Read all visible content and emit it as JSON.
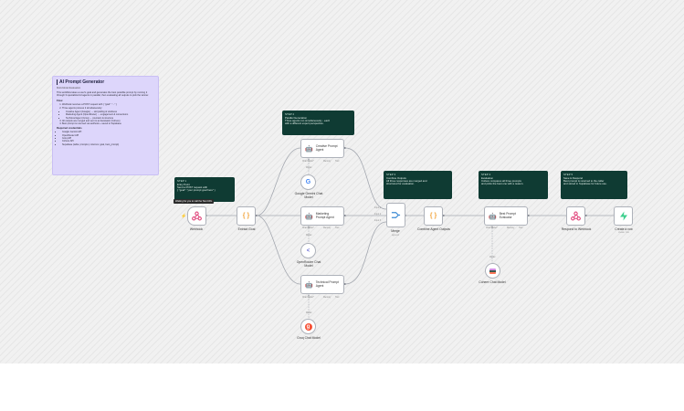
{
  "note": {
    "title": "AI Prompt Generator",
    "subtitle": "Multi-Model Evaluation",
    "description": "This workflow takes a user's goal and generates the best possible prompt by running it through 3 specialized AI agents in parallel, then evaluating all outputs to pick the winner.",
    "flow_heading": "Flow",
    "flow_steps": [
      "Webhook receives a POST request with { \"goal\": \"...\" }",
      "Three agents process it simultaneously:"
    ],
    "flow_sub": [
      "Creative Agent (Google) → storytelling & vividness",
      "Marketing Agent (OpenRouter) → engagement & conversions",
      "Technical Agent (Groq) → precision & structure"
    ],
    "flow_steps_2": [
      "All outputs are merged and sent to an Evaluator (Cohere)",
      "Best prompt is returned via webhook + saved to Supabase"
    ],
    "credentials_heading": "Required credentials",
    "credentials": [
      "Google Gemini API",
      "OpenRouter API",
      "Groq API",
      "Cohere API",
      "Supabase (table: prompts | columns: goal, best_prompt)"
    ]
  },
  "steps": {
    "s1": {
      "title": "STEP 1",
      "lines": [
        "Entry Point",
        "Send a POST request with",
        "{ \"goal\": \"your prompt goal here\" }"
      ]
    },
    "s2": {
      "title": "STEP 2",
      "lines": [
        "Parallel Generation",
        "Three agents run simultaneously - each",
        "with a different expert perspective."
      ]
    },
    "s3": {
      "title": "STEP 3",
      "lines": [
        "Combine Outputs",
        "All three responses are merged and",
        "structured for evaluation."
      ]
    },
    "s4": {
      "title": "STEP 4",
      "lines": [
        "Evaluation",
        "Cohere compares all three prompts",
        "and picks the best one with a reason."
      ]
    },
    "s5": {
      "title": "STEP 5",
      "lines": [
        "Save & Respond",
        "Best prompt is returned to the caller",
        "and stored in Supabase for future use."
      ]
    }
  },
  "nodes": {
    "webhook": "Webhook",
    "waiting_badge": "Waiting for you to call the Test URL",
    "extract_goal": "Extract Goal",
    "creative_agent": "Creative Prompt Agent",
    "marketing_agent": "Marketing Prompt Agent",
    "technical_agent": "Technical Prompt Agent",
    "google_model": "Google Gemini Chat Model",
    "openrouter_model": "OpenRouter Chat Model",
    "groq_model": "Groq Chat Model",
    "merge": "Merge",
    "merge_sub": "append",
    "combine": "Combine Agent Outputs",
    "evaluator": "Best Prompt Evaluator",
    "cohere_model": "Cohere Chat Model",
    "respond": "Respond to Webhook",
    "supabase": "Create a row",
    "supabase_sub": "create: row"
  },
  "ports": {
    "chat_model": "Chat Model*",
    "memory": "Memory",
    "tool": "Tool",
    "model": "Model",
    "input1": "Input 1",
    "input2": "Input 2",
    "input3": "Input 3"
  },
  "colors": {
    "canvas": "#f1f1f1",
    "note": "#ddd6fb",
    "step": "#0f3b33",
    "webhook": "#e0437a",
    "code": "#f2a33a",
    "merge": "#3d8bd4",
    "supabase": "#3ecf8e",
    "groq": "#f55036"
  }
}
